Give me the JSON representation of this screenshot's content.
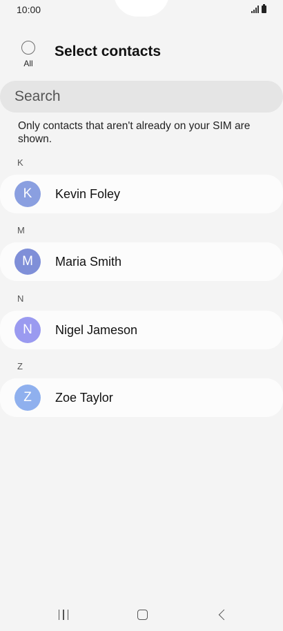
{
  "status_bar": {
    "time": "10:00"
  },
  "header": {
    "select_all_label": "All",
    "title": "Select contacts"
  },
  "search": {
    "placeholder": "Search"
  },
  "info_text": "Only contacts that aren't already on your SIM are shown.",
  "contacts": [
    {
      "section": "K",
      "initial": "K",
      "name": "Kevin Foley",
      "avatar_color": "#8a9fe0"
    },
    {
      "section": "M",
      "initial": "M",
      "name": "Maria Smith",
      "avatar_color": "#7f8fd8"
    },
    {
      "section": "N",
      "initial": "N",
      "name": "Nigel Jameson",
      "avatar_color": "#9a9af0"
    },
    {
      "section": "Z",
      "initial": "Z",
      "name": "Zoe Taylor",
      "avatar_color": "#8fb0ee"
    }
  ],
  "nav_icons": [
    "recents-icon",
    "home-icon",
    "back-icon"
  ]
}
